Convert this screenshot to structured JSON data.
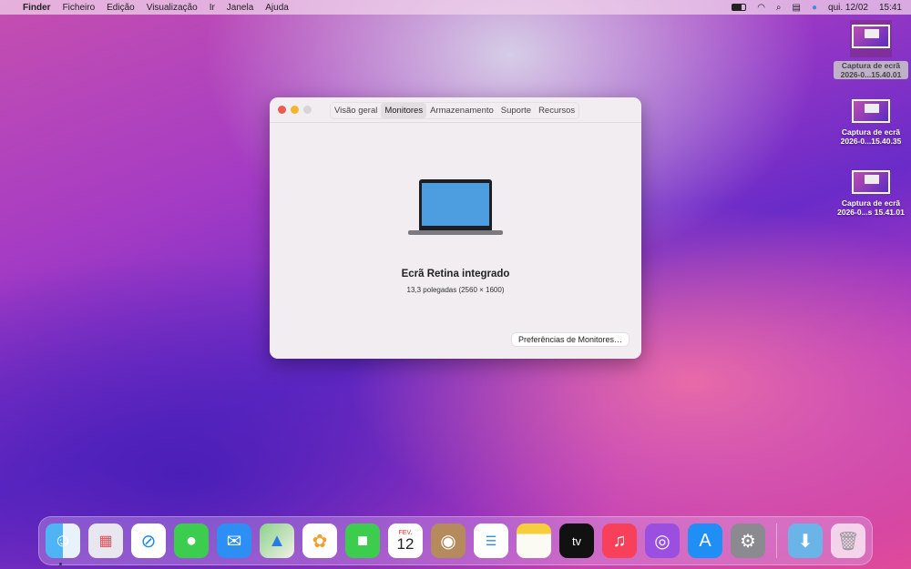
{
  "menubar": {
    "apple": "",
    "app": "Finder",
    "items": [
      "Ficheiro",
      "Edição",
      "Visualização",
      "Ir",
      "Janela",
      "Ajuda"
    ],
    "date": "qui. 12/02",
    "time": "15:41"
  },
  "window": {
    "tabs": [
      "Visão geral",
      "Monitores",
      "Armazenamento",
      "Suporte",
      "Recursos"
    ],
    "active_tab": "Monitores",
    "title": "Ecrã Retina integrado",
    "subtitle": "13,3 polegadas (2560 × 1600)",
    "button": "Preferências de Monitores…"
  },
  "desktop": [
    {
      "line1": "Captura de ecrã",
      "line2": "2026-0...15.40.01"
    },
    {
      "line1": "Captura de ecrã",
      "line2": "2026-0...15.40.35"
    },
    {
      "line1": "Captura de ecrã",
      "line2": "2026-0...s 15.41.01"
    }
  ],
  "dock": {
    "calendar_month": "FEV.",
    "calendar_day": "12",
    "tv_label": "tv",
    "apps": [
      "finder",
      "launchpad",
      "safari",
      "messages",
      "mail",
      "maps",
      "photos",
      "facetime",
      "calendar",
      "contacts",
      "reminders",
      "notes",
      "tv",
      "music",
      "podcasts",
      "app-store",
      "system-preferences",
      "downloads",
      "trash"
    ]
  }
}
